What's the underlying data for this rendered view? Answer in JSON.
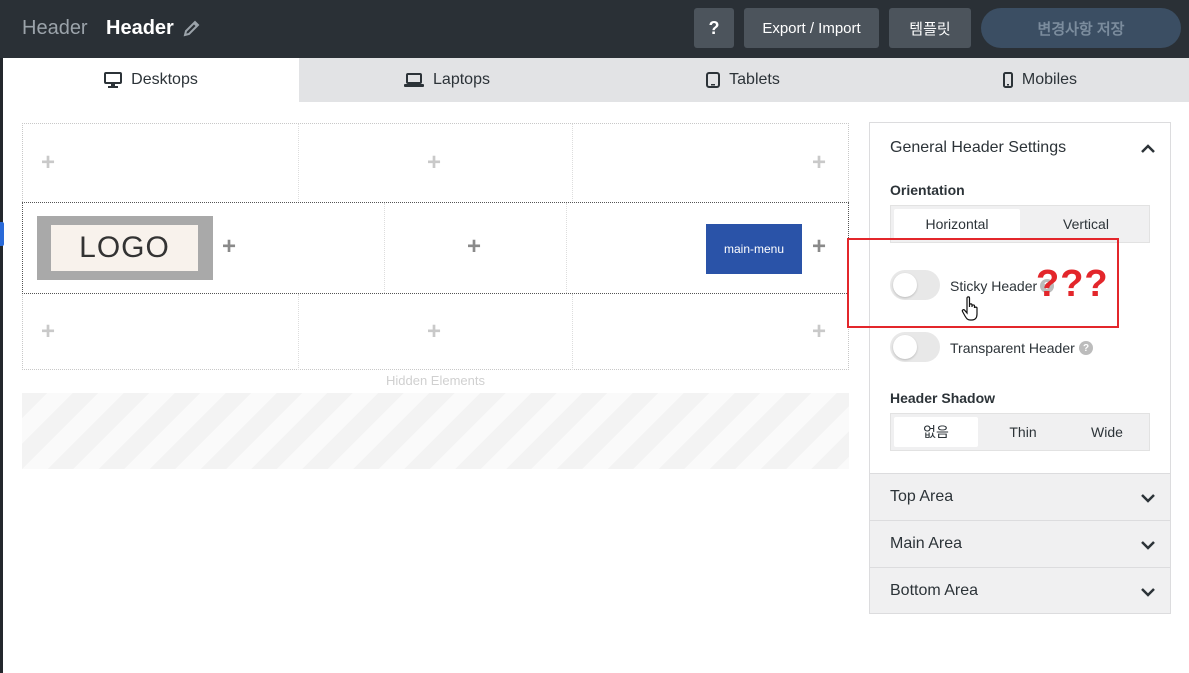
{
  "header": {
    "breadcrumb": "Header",
    "title": "Header",
    "help_label": "?",
    "export_label": "Export / Import",
    "template_label": "템플릿",
    "save_label": "변경사항 저장"
  },
  "tabs": [
    {
      "label": "Desktops",
      "icon": "desktop-icon",
      "active": true
    },
    {
      "label": "Laptops",
      "icon": "laptop-icon",
      "active": false
    },
    {
      "label": "Tablets",
      "icon": "tablet-icon",
      "active": false
    },
    {
      "label": "Mobiles",
      "icon": "mobile-icon",
      "active": false
    }
  ],
  "canvas": {
    "logo_text": "LOGO",
    "menu_label": "main-menu",
    "add_symbol": "+",
    "hidden_label": "Hidden Elements"
  },
  "panel": {
    "title": "General Header Settings",
    "orientation": {
      "label": "Orientation",
      "options": [
        "Horizontal",
        "Vertical"
      ],
      "selected": "Horizontal"
    },
    "sticky_header": {
      "label": "Sticky Header",
      "enabled": false
    },
    "transparent_header": {
      "label": "Transparent Header",
      "enabled": false
    },
    "help_symbol": "?",
    "shadow": {
      "label": "Header Shadow",
      "options": [
        "없음",
        "Thin",
        "Wide"
      ],
      "selected": "없음"
    },
    "sections": [
      "Top Area",
      "Main Area",
      "Bottom Area"
    ]
  },
  "annotation": {
    "text": "???",
    "color": "#e3262b"
  },
  "colors": {
    "topbar": "#2a3036",
    "menu_button": "#2a53a8",
    "save_button": "#3b4e63",
    "annotation": "#e3262b"
  }
}
